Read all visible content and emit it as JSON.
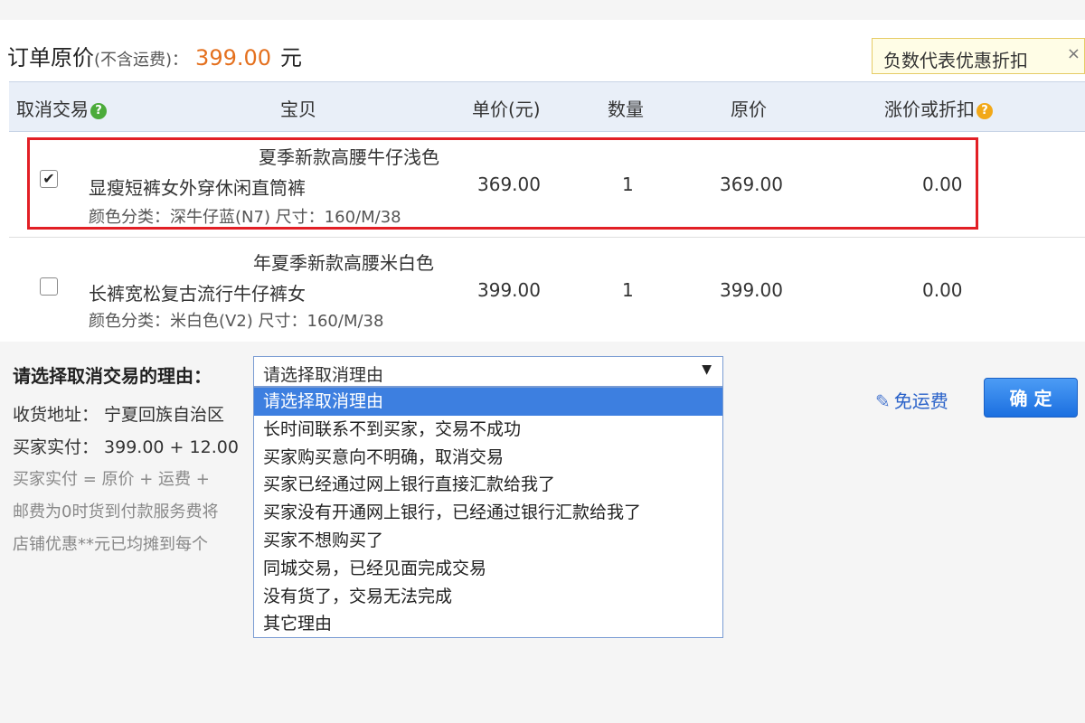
{
  "order": {
    "label": "订单原价",
    "paren": "(不含运费)：",
    "price": "399.00",
    "unit": "元"
  },
  "tooltip": {
    "text": "负数代表优惠折扣",
    "close": "×"
  },
  "table": {
    "headers": [
      "取消交易",
      "宝贝",
      "单价(元)",
      "数量",
      "原价",
      "涨价或折扣"
    ],
    "rows": [
      {
        "checked": "✔",
        "title1": "夏季新款高腰牛仔浅色",
        "title2": "显瘦短裤女外穿休闲直筒裤",
        "sku": "颜色分类：深牛仔蓝(N7)  尺寸：160/M/38",
        "price": "369.00",
        "qty": "1",
        "orig": "369.00",
        "discount": "0.00"
      },
      {
        "checked": "",
        "title1": "年夏季新款高腰米白色",
        "title2": "长裤宽松复古流行牛仔裤女",
        "sku": "颜色分类：米白色(V2)  尺寸：160/M/38",
        "price": "399.00",
        "qty": "1",
        "orig": "399.00",
        "discount": "0.00"
      }
    ]
  },
  "reason": {
    "label": "请选择取消交易的理由：",
    "selected": "请选择取消理由",
    "options": [
      "请选择取消理由",
      "长时间联系不到买家，交易不成功",
      "买家购买意向不明确，取消交易",
      "买家已经通过网上银行直接汇款给我了",
      "买家没有开通网上银行，已经通过银行汇款给我了",
      "买家不想购买了",
      "同城交易，已经见面完成交易",
      "没有货了，交易无法完成",
      "其它理由"
    ]
  },
  "info": {
    "address": "收货地址：  宁夏回族自治区",
    "paid": "买家实付：  399.00 + 12.00",
    "formula": "买家实付 = 原价 + 运费 +",
    "shipping_note": "邮费为0时货到付款服务费将",
    "shop_discount": "店铺优惠**元已均摊到每个"
  },
  "actions": {
    "free_shipping": "免运费",
    "confirm": "确 定"
  },
  "icons": {
    "pencil": "pencil-icon",
    "help_green": "help-icon",
    "help_orange": "help-icon"
  },
  "colors": {
    "price": "#e4701e",
    "highlight": "#e21f25",
    "selected": "#3d7fe0",
    "link": "#2a62c9"
  }
}
